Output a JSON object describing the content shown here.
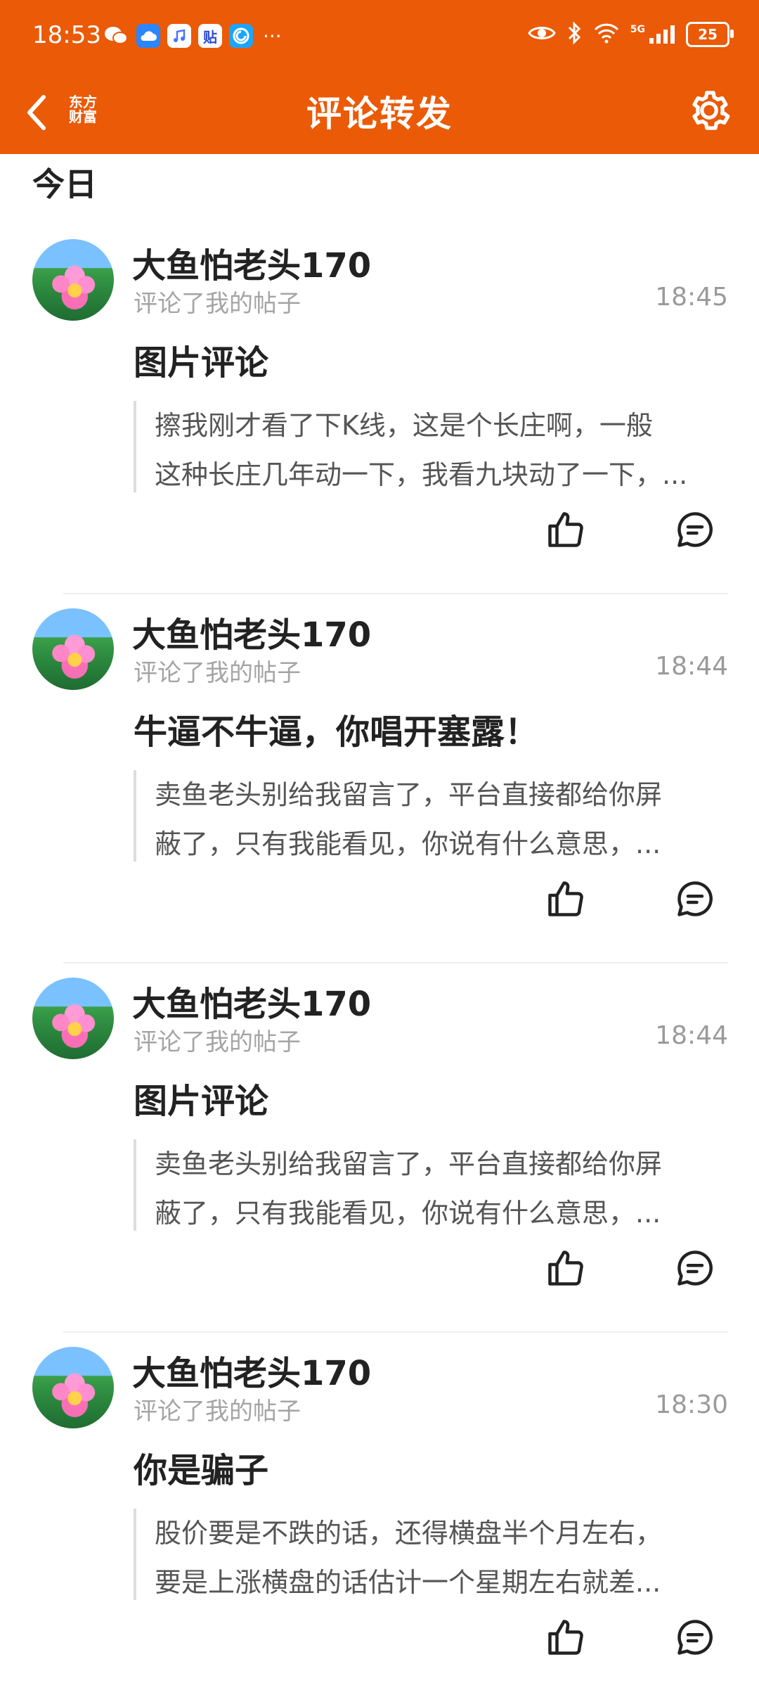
{
  "statusbar": {
    "time": "18:53",
    "icons": [
      "wechat-icon",
      "cloud-app-icon",
      "music-app-icon",
      "tieba-app-icon",
      "browser-app-icon",
      "more-dots"
    ],
    "more": "···",
    "battery": "25",
    "network": "5G"
  },
  "header": {
    "title": "评论转发",
    "logo_line1": "东方",
    "logo_line2": "财富",
    "accent": "#ea5a07"
  },
  "section": {
    "label": "今日"
  },
  "feed": {
    "items": [
      {
        "name": "大鱼怕老头170",
        "action": "评论了我的帖子",
        "time": "18:45",
        "title": "图片评论",
        "quote_line1": "擦我刚才看了下K线，这是个长庄啊，一般",
        "quote_line2": "这种长庄几年动一下，我看九块动了一下，..."
      },
      {
        "name": "大鱼怕老头170",
        "action": "评论了我的帖子",
        "time": "18:44",
        "title": "牛逼不牛逼，你唱开塞露！",
        "quote_line1": "卖鱼老头别给我留言了，平台直接都给你屏",
        "quote_line2": "蔽了，只有我能看见，你说有什么意思，..."
      },
      {
        "name": "大鱼怕老头170",
        "action": "评论了我的帖子",
        "time": "18:44",
        "title": "图片评论",
        "quote_line1": "卖鱼老头别给我留言了，平台直接都给你屏",
        "quote_line2": "蔽了，只有我能看见，你说有什么意思，..."
      },
      {
        "name": "大鱼怕老头170",
        "action": "评论了我的帖子",
        "time": "18:30",
        "title": "你是骗子",
        "quote_line1": "股价要是不跌的话，还得横盘半个月左右，",
        "quote_line2": "要是上涨横盘的话估计一个星期左右就差..."
      }
    ]
  }
}
